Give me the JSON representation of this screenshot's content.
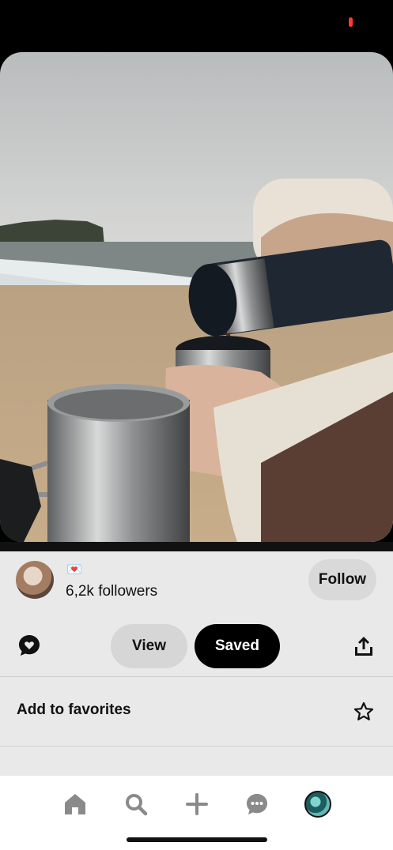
{
  "colors": {
    "accent_black": "#000000",
    "sheet_bg": "#e9e9e9",
    "recording_dot": "#ff3b30"
  },
  "pin": {
    "image_description_icon": "photo",
    "creator": {
      "emoji": "💌",
      "followers": "6,2k followers"
    },
    "follow_label": "Follow",
    "view_label": "View",
    "saved_label": "Saved"
  },
  "menu": {
    "add_to_favorites": "Add to favorites"
  },
  "icons": {
    "comment": "comment-icon",
    "share": "share-icon",
    "star": "star-icon",
    "home": "home-icon",
    "search": "search-icon",
    "create": "plus-icon",
    "messages": "chat-icon",
    "profile": "profile-avatar"
  }
}
